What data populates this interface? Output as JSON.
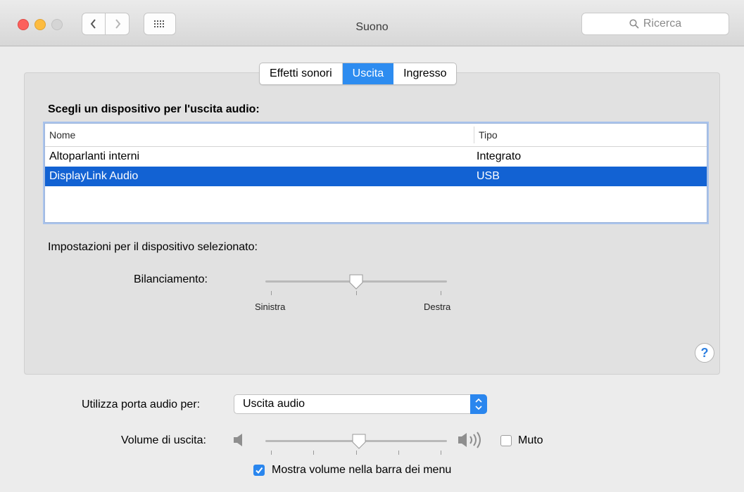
{
  "window": {
    "title": "Suono"
  },
  "toolbar": {
    "search_placeholder": "Ricerca"
  },
  "tabs": [
    {
      "label": "Effetti sonori",
      "active": false
    },
    {
      "label": "Uscita",
      "active": true
    },
    {
      "label": "Ingresso",
      "active": false
    }
  ],
  "output": {
    "section_title": "Scegli un dispositivo per l'uscita audio:",
    "columns": [
      "Nome",
      "Tipo"
    ],
    "rows": [
      {
        "name": "Altoparlanti interni",
        "type": "Integrato",
        "selected": false
      },
      {
        "name": "DisplayLink Audio",
        "type": "USB",
        "selected": true
      }
    ]
  },
  "device_settings": {
    "title": "Impostazioni per il dispositivo selezionato:",
    "balance_label": "Bilanciamento:",
    "balance_value": 0.5,
    "left_label": "Sinistra",
    "right_label": "Destra"
  },
  "help_label": "?",
  "audio_port": {
    "label": "Utilizza porta audio per:",
    "value": "Uscita audio"
  },
  "volume": {
    "label": "Volume di uscita:",
    "value": 0.5,
    "mute_label": "Muto",
    "mute_checked": false
  },
  "show_volume": {
    "label": "Mostra volume nella barra dei menu",
    "checked": true
  },
  "colors": {
    "accent": "#2a86ee",
    "selection": "#1262d3"
  }
}
